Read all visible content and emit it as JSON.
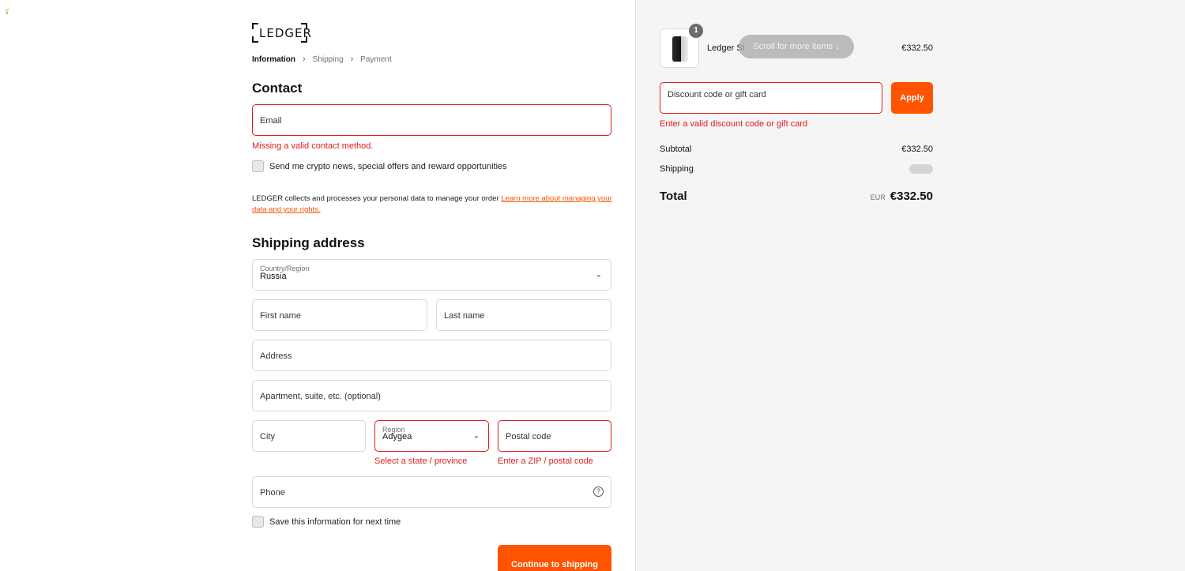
{
  "corner_mark": "ﻛ",
  "brand": {
    "logo_text": "LEDGER"
  },
  "breadcrumb": {
    "items": [
      "Information",
      "Shipping",
      "Payment"
    ]
  },
  "contact": {
    "heading": "Contact",
    "email_placeholder": "Email",
    "email_error": "Missing a valid contact method.",
    "newsletter_label": "Send me crypto news, special offers and reward opportunities"
  },
  "privacy": {
    "text": "LEDGER collects and processes your personal data to manage your order ",
    "link": "Learn more about managing your data and your rights."
  },
  "shipping": {
    "heading": "Shipping address",
    "country_label": "Country/Region",
    "country_value": "Russia",
    "first_name": "First name",
    "last_name": "Last name",
    "address": "Address",
    "apartment": "Apartment, suite, etc. (optional)",
    "city": "City",
    "region_label": "Region",
    "region_value": "Adygea",
    "region_error": "Select a state / province",
    "postal": "Postal code",
    "postal_error": "Enter a ZIP / postal code",
    "phone": "Phone",
    "save_label": "Save this information for next time",
    "continue_button": "Continue to shipping"
  },
  "summary": {
    "product_name": "Ledger St",
    "quantity_badge": "1",
    "scroll_hint": "Scroll for more items",
    "product_price": "€332.50",
    "discount_placeholder": "Discount code or gift card",
    "apply_button": "Apply",
    "discount_error": "Enter a valid discount code or gift card",
    "subtotal_label": "Subtotal",
    "subtotal_value": "€332.50",
    "shipping_label": "Shipping",
    "total_label": "Total",
    "currency": "EUR",
    "total_value": "€332.50"
  },
  "colors": {
    "accent": "#ff5300",
    "error": "#dd1d1d",
    "sidebar_bg": "#f5f5f5"
  },
  "icons": {
    "help": "question-circle-icon",
    "chevron": "chevron-down-icon",
    "arrow": "arrow-down-icon"
  }
}
